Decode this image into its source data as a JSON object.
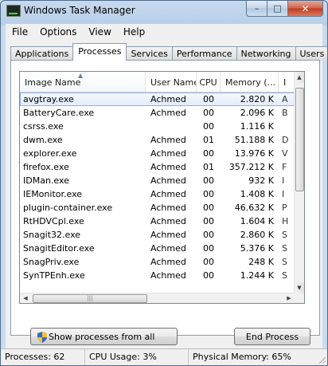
{
  "window": {
    "title": "Windows Task Manager"
  },
  "caption_buttons": {
    "minimize": "–",
    "maximize": "□",
    "close": "✕"
  },
  "menu": [
    "File",
    "Options",
    "View",
    "Help"
  ],
  "tabs": [
    "Applications",
    "Processes",
    "Services",
    "Performance",
    "Networking",
    "Users"
  ],
  "active_tab": "Processes",
  "columns": {
    "name": "Image Name",
    "user": "User Name",
    "cpu": "CPU",
    "memory": "Memory (...",
    "more": "I"
  },
  "processes": [
    {
      "name": "avgtray.exe",
      "user": "Achmed",
      "cpu": "00",
      "memory": "2.820 K",
      "desc": "A"
    },
    {
      "name": "BatteryCare.exe",
      "user": "Achmed",
      "cpu": "00",
      "memory": "2.096 K",
      "desc": "B"
    },
    {
      "name": "csrss.exe",
      "user": "",
      "cpu": "00",
      "memory": "1.116 K",
      "desc": ""
    },
    {
      "name": "dwm.exe",
      "user": "Achmed",
      "cpu": "01",
      "memory": "51.188 K",
      "desc": "D"
    },
    {
      "name": "explorer.exe",
      "user": "Achmed",
      "cpu": "00",
      "memory": "13.976 K",
      "desc": "V"
    },
    {
      "name": "firefox.exe",
      "user": "Achmed",
      "cpu": "01",
      "memory": "357.212 K",
      "desc": "F"
    },
    {
      "name": "IDMan.exe",
      "user": "Achmed",
      "cpu": "00",
      "memory": "932 K",
      "desc": "I"
    },
    {
      "name": "IEMonitor.exe",
      "user": "Achmed",
      "cpu": "00",
      "memory": "1.408 K",
      "desc": "I"
    },
    {
      "name": "plugin-container.exe",
      "user": "Achmed",
      "cpu": "00",
      "memory": "46.632 K",
      "desc": "P"
    },
    {
      "name": "RtHDVCpl.exe",
      "user": "Achmed",
      "cpu": "00",
      "memory": "1.604 K",
      "desc": "H"
    },
    {
      "name": "Snagit32.exe",
      "user": "Achmed",
      "cpu": "00",
      "memory": "2.860 K",
      "desc": "S"
    },
    {
      "name": "SnagitEditor.exe",
      "user": "Achmed",
      "cpu": "00",
      "memory": "5.376 K",
      "desc": "S"
    },
    {
      "name": "SnagPriv.exe",
      "user": "Achmed",
      "cpu": "00",
      "memory": "248 K",
      "desc": "S"
    },
    {
      "name": "SynTPEnh.exe",
      "user": "Achmed",
      "cpu": "00",
      "memory": "1.244 K",
      "desc": "S"
    }
  ],
  "selected_row": 0,
  "buttons": {
    "show_all": "Show processes from all users",
    "end_process": "End Process"
  },
  "status": {
    "processes": "Processes: 62",
    "cpu": "CPU Usage: 3%",
    "memory": "Physical Memory: 65%"
  },
  "colors": {
    "title_bar": "#c6d9ee",
    "selection": "#e1ecf9",
    "close_button": "#c94a2f"
  }
}
